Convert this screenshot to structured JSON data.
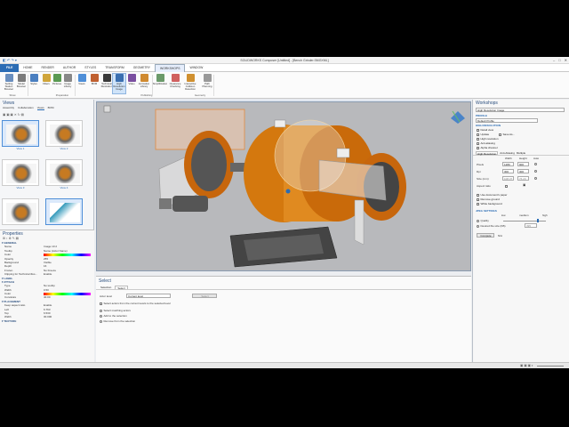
{
  "window": {
    "title": "SOLIDWORKS Composer [Untitled] - [Bench Grinder.SMGXML]"
  },
  "menu_tabs": [
    "FILE",
    "HOME",
    "RENDER",
    "AUTHOR",
    "STYLES",
    "TRANSFORM",
    "GEOMETRY",
    "WORKSHOPS",
    "WINDOW"
  ],
  "active_menu_tab": "WORKSHOPS",
  "ribbon": {
    "buttons": [
      {
        "label": "Setting Station Browser",
        "color": "#6a8fbf"
      },
      {
        "label": "Model Browser",
        "color": "#7c7c7c"
      },
      {
        "label": "Styles",
        "color": "#4a7fc0"
      },
      {
        "label": "Filters",
        "color": "#d0a53a"
      },
      {
        "label": "Pictures",
        "color": "#5a9a52"
      },
      {
        "label": "Image Library",
        "color": "#888"
      },
      {
        "label": "Views",
        "color": "#4f8fd8"
      },
      {
        "label": "BOM",
        "color": "#c06030"
      },
      {
        "label": "Technical Illustration",
        "color": "#3a3a3a"
      },
      {
        "label": "High Resolution Image",
        "color": "#3a6fb0"
      },
      {
        "label": "Video",
        "color": "#7a4fa0"
      },
      {
        "label": "Animation Library",
        "color": "#d08a30"
      },
      {
        "label": "Simplification",
        "color": "#6a9a6a"
      },
      {
        "label": "Clearance Checking",
        "color": "#d06060"
      },
      {
        "label": "Interactive Collision Detection",
        "color": "#d09030"
      },
      {
        "label": "Path Planning",
        "color": "#999"
      }
    ],
    "groups": [
      "Show",
      "Preparation",
      "Publishing",
      "Geometry"
    ]
  },
  "views_panel": {
    "title": "Views",
    "tabs": [
      "Assembly",
      "Collaboration",
      "Views",
      "BOM"
    ],
    "thumbs": [
      "View 1",
      "View 2",
      "View 3",
      "View 4",
      "",
      ""
    ]
  },
  "properties": {
    "title": "Properties",
    "sections": [
      {
        "name": "GENERAL",
        "rows": [
          [
            "Name",
            "Image 10 2"
          ],
          [
            "Tooltip",
            "Name (Actor Name)"
          ],
          [
            "Color",
            ""
          ],
          [
            "Opacity",
            "255"
          ],
          [
            "Background",
            "Visible"
          ],
          [
            "Depth",
            "16"
          ],
          [
            "Frozen",
            "No Freeze"
          ],
          [
            "Clipping for Technical illus...",
            "Enable"
          ]
        ]
      },
      {
        "name": "LABEL",
        "rows": []
      },
      {
        "name": "ATTACH",
        "rows": [
          [
            "Type",
            "No tooltip"
          ],
          [
            "Width",
            "0.50"
          ],
          [
            "Color",
            ""
          ],
          [
            "Curvature",
            "40.00"
          ]
        ]
      },
      {
        "name": "PLACEMENT",
        "rows": [
          [
            "Keep aspect ratio",
            "Enable"
          ],
          [
            "Left",
            "6.763"
          ],
          [
            "Top",
            "6.530"
          ],
          [
            "Width",
            "30.000"
          ]
        ]
      },
      {
        "name": "TEXTURE",
        "rows": []
      }
    ]
  },
  "viewport": {
    "tab": "Bench Grinder.SMGXML"
  },
  "select_panel": {
    "title": "Select",
    "tabs": [
      "Selection",
      "Select"
    ],
    "actor_level_label": "Actor level",
    "actor_level_value": "Current level",
    "apply_button": "Select",
    "checkbox": "Select actors from the current levels to the selected level",
    "radios": [
      "Select matching actors",
      "Add to the selection",
      "Remove from the selection"
    ]
  },
  "workshops": {
    "title": "Workshops",
    "dropdown": "High Resolution Image",
    "profile_label": "PROFILE",
    "profile_value": "Default Profile",
    "hr_label": "HIGH RESOLUTION",
    "detail_row": "Detail view",
    "update_label": "Update",
    "save_label": "Save As...",
    "checks": [
      "High resolution",
      "Anti-aliasing",
      "Alpha channel"
    ],
    "tabs": [
      "High Resolution",
      "Anti-Aliasing",
      "Multiple"
    ],
    "cols": [
      "Width",
      "Height",
      "Auto"
    ],
    "rows": [
      {
        "label": "Pixels",
        "w": "1280",
        "h": "900"
      },
      {
        "label": "Dpi",
        "w": "300",
        "h": "300"
      },
      {
        "label": "Size (mm)",
        "w": "108.37",
        "h": "76.20"
      }
    ],
    "aspect_label": "Aspect ratio",
    "more_checks": [
      "Use document's paper",
      "Remove ground",
      "White background"
    ],
    "jpeg_label": "JPEG SETTINGS",
    "quality_scale": [
      "low",
      "medium",
      "high"
    ],
    "quality_label": "Quality",
    "filesize_label": "Desired file size (KB)",
    "filesize_value": "395",
    "compute_label": "Compute",
    "na_label": "N/A"
  }
}
